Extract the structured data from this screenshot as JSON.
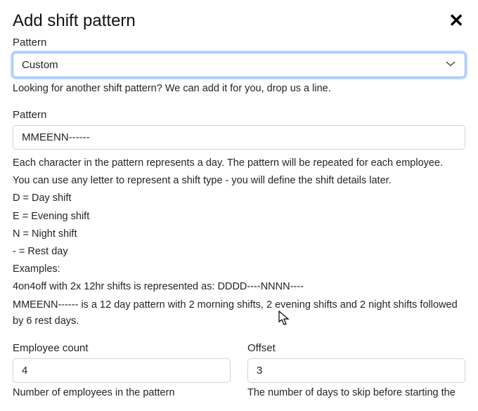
{
  "header": {
    "title": "Add shift pattern"
  },
  "pattern_select": {
    "label": "Pattern",
    "value": "Custom",
    "help": "Looking for another shift pattern? We can add it for you, drop us a line."
  },
  "pattern_text": {
    "label": "Pattern",
    "value": "MMEENN------",
    "desc_line1": "Each character in the pattern represents a day. The pattern will be repeated for each employee.",
    "desc_line2": "You can use any letter to represent a shift type - you will define the shift details later.",
    "legend_d": "D = Day shift",
    "legend_e": "E = Evening shift",
    "legend_n": "N = Night shift",
    "legend_rest": "- = Rest day",
    "examples_label": "Examples:",
    "example1": "4on4off with 2x 12hr shifts is represented as: DDDD----NNNN----",
    "example2": "MMEENN------ is a 12 day pattern with 2 morning shifts, 2 evening shifts and 2 night shifts followed by 6 rest days."
  },
  "employee_count": {
    "label": "Employee count",
    "value": "4",
    "help": "Number of employees in the pattern"
  },
  "offset": {
    "label": "Offset",
    "value": "3",
    "help": "The number of days to skip before starting the"
  }
}
